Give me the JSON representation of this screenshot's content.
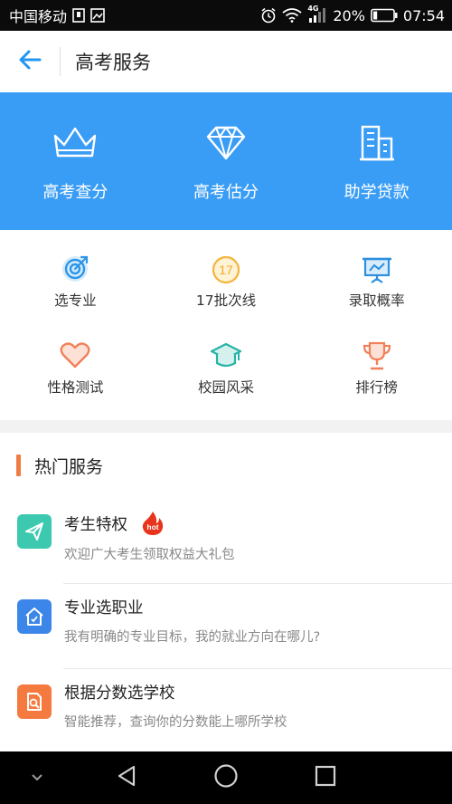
{
  "status_bar": {
    "carrier": "中国移动",
    "network": "4G",
    "battery": "20%",
    "battery_level": 0.2,
    "time": "07:54"
  },
  "header": {
    "title": "高考服务"
  },
  "banner": {
    "items": [
      {
        "label": "高考查分",
        "icon": "crown-icon"
      },
      {
        "label": "高考估分",
        "icon": "diamond-icon"
      },
      {
        "label": "助学贷款",
        "icon": "building-icon"
      }
    ]
  },
  "grid": {
    "items": [
      {
        "label": "选专业",
        "icon": "target-icon"
      },
      {
        "label": "17批次线",
        "icon": "calendar-17-icon",
        "icon_text": "17"
      },
      {
        "label": "录取概率",
        "icon": "presentation-chart-icon"
      },
      {
        "label": "性格测试",
        "icon": "heart-icon"
      },
      {
        "label": "校园风采",
        "icon": "graduation-cap-icon"
      },
      {
        "label": "排行榜",
        "icon": "trophy-icon"
      }
    ]
  },
  "hot_services": {
    "title": "热门服务",
    "items": [
      {
        "title": "考生特权",
        "desc": "欢迎广大考生领取权益大礼包",
        "badge": "hot",
        "icon": "paper-plane-icon",
        "color": "#3cc9b0"
      },
      {
        "title": "专业选职业",
        "desc": "我有明确的专业目标，我的就业方向在哪儿?",
        "icon": "house-icon",
        "color": "#3b86e8"
      },
      {
        "title": "根据分数选学校",
        "desc": "智能推荐，查询你的分数能上哪所学校",
        "icon": "search-document-icon",
        "color": "#f57a3f"
      }
    ]
  },
  "colors": {
    "banner": "#3a9df5",
    "accent_orange": "#f07b43",
    "hot_red": "#e8341c"
  }
}
